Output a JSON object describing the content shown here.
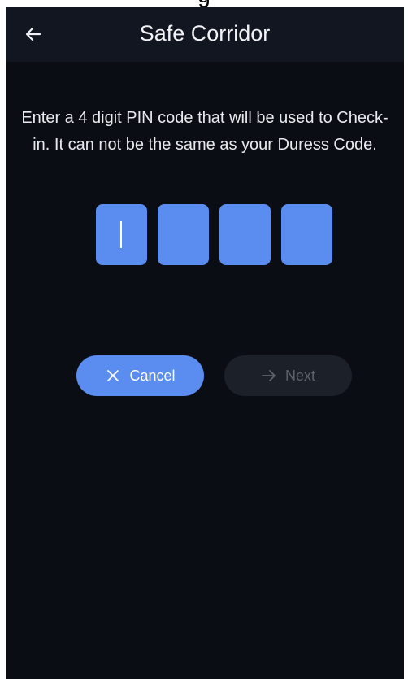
{
  "status_fragment": "g",
  "header": {
    "title": "Safe Corridor",
    "back_icon": "arrow-left-icon"
  },
  "instructions": "Enter a 4 digit PIN code that will be used to Check-in. It can not be the same as your Duress Code.",
  "pin": {
    "length": 4,
    "digits": [
      "",
      "",
      "",
      ""
    ],
    "focused_index": 0
  },
  "actions": {
    "cancel_label": "Cancel",
    "cancel_icon": "close-icon",
    "next_label": "Next",
    "next_icon": "arrow-right-icon",
    "next_enabled": false
  },
  "colors": {
    "background": "#0a0d14",
    "app_bar": "#111620",
    "accent": "#5a8def",
    "disabled_button": "#1c2029",
    "disabled_text": "#5d626d"
  }
}
